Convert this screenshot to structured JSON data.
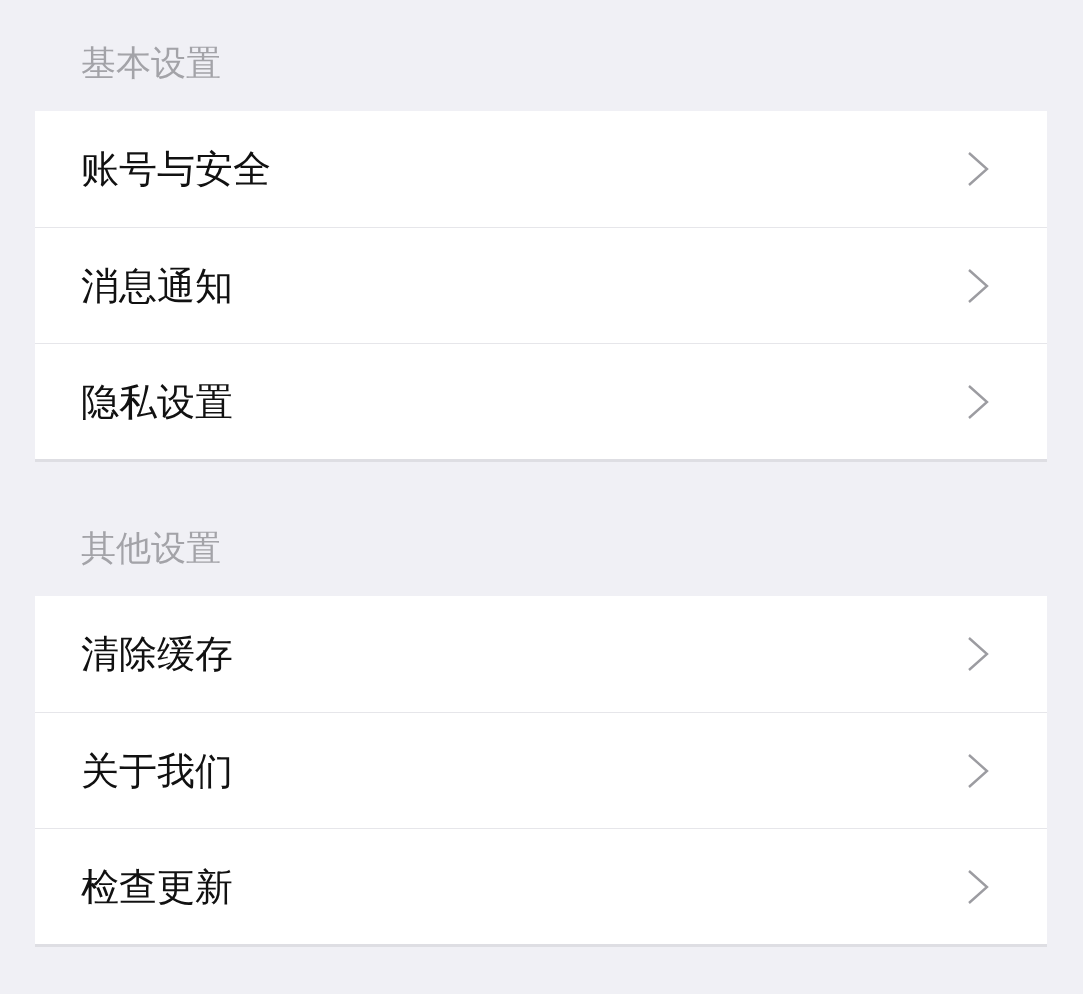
{
  "sections": [
    {
      "title": "基本设置",
      "items": [
        {
          "label": "账号与安全"
        },
        {
          "label": "消息通知"
        },
        {
          "label": "隐私设置"
        }
      ]
    },
    {
      "title": "其他设置",
      "items": [
        {
          "label": "清除缓存"
        },
        {
          "label": "关于我们"
        },
        {
          "label": "检查更新"
        }
      ]
    }
  ]
}
